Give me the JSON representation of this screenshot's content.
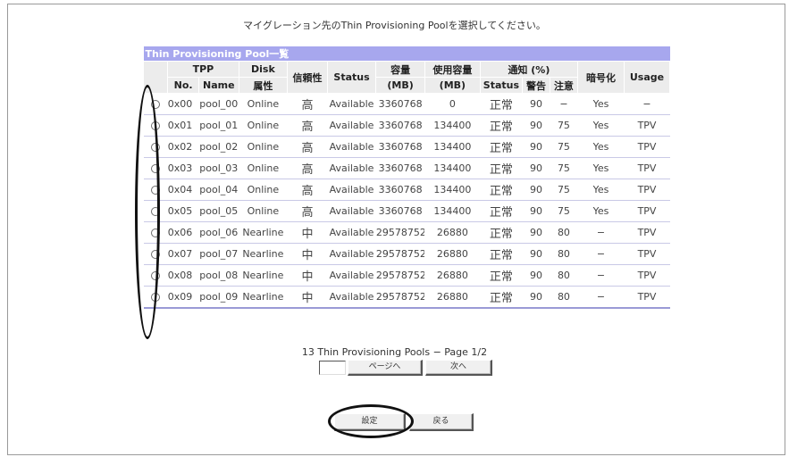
{
  "instruction": "マイグレーション先のThin Provisioning Poolを選択してください。",
  "table": {
    "title": "Thin Provisioning Pool一覧",
    "headers": {
      "tpp": "TPP",
      "no": "No.",
      "name": "Name",
      "disk_line1": "Disk",
      "disk_line2": "属性",
      "reliability": "信頼性",
      "status": "Status",
      "capacity_line1": "容量",
      "capacity_line2": "(MB)",
      "used_line1": "使用容量",
      "used_line2": "(MB)",
      "notify": "通知 (%)",
      "notify_status": "Status",
      "notify_warning": "警告",
      "notify_caution": "注意",
      "encryption": "暗号化",
      "usage": "Usage"
    },
    "rows": [
      {
        "no": "0x00",
        "name": "pool_00",
        "disk": "Online",
        "rel": "高",
        "status": "Available",
        "cap": "3360768",
        "used": "0",
        "nstat": "正常",
        "warn": "90",
        "caut": "−",
        "enc": "Yes",
        "usage": "−"
      },
      {
        "no": "0x01",
        "name": "pool_01",
        "disk": "Online",
        "rel": "高",
        "status": "Available",
        "cap": "3360768",
        "used": "134400",
        "nstat": "正常",
        "warn": "90",
        "caut": "75",
        "enc": "Yes",
        "usage": "TPV"
      },
      {
        "no": "0x02",
        "name": "pool_02",
        "disk": "Online",
        "rel": "高",
        "status": "Available",
        "cap": "3360768",
        "used": "134400",
        "nstat": "正常",
        "warn": "90",
        "caut": "75",
        "enc": "Yes",
        "usage": "TPV"
      },
      {
        "no": "0x03",
        "name": "pool_03",
        "disk": "Online",
        "rel": "高",
        "status": "Available",
        "cap": "3360768",
        "used": "134400",
        "nstat": "正常",
        "warn": "90",
        "caut": "75",
        "enc": "Yes",
        "usage": "TPV"
      },
      {
        "no": "0x04",
        "name": "pool_04",
        "disk": "Online",
        "rel": "高",
        "status": "Available",
        "cap": "3360768",
        "used": "134400",
        "nstat": "正常",
        "warn": "90",
        "caut": "75",
        "enc": "Yes",
        "usage": "TPV"
      },
      {
        "no": "0x05",
        "name": "pool_05",
        "disk": "Online",
        "rel": "高",
        "status": "Available",
        "cap": "3360768",
        "used": "134400",
        "nstat": "正常",
        "warn": "90",
        "caut": "75",
        "enc": "Yes",
        "usage": "TPV"
      },
      {
        "no": "0x06",
        "name": "pool_06",
        "disk": "Nearline",
        "rel": "中",
        "status": "Available",
        "cap": "29578752",
        "used": "26880",
        "nstat": "正常",
        "warn": "90",
        "caut": "80",
        "enc": "−",
        "usage": "TPV"
      },
      {
        "no": "0x07",
        "name": "pool_07",
        "disk": "Nearline",
        "rel": "中",
        "status": "Available",
        "cap": "29578752",
        "used": "26880",
        "nstat": "正常",
        "warn": "90",
        "caut": "80",
        "enc": "−",
        "usage": "TPV"
      },
      {
        "no": "0x08",
        "name": "pool_08",
        "disk": "Nearline",
        "rel": "中",
        "status": "Available",
        "cap": "29578752",
        "used": "26880",
        "nstat": "正常",
        "warn": "90",
        "caut": "80",
        "enc": "−",
        "usage": "TPV"
      },
      {
        "no": "0x09",
        "name": "pool_09",
        "disk": "Nearline",
        "rel": "中",
        "status": "Available",
        "cap": "29578752",
        "used": "26880",
        "nstat": "正常",
        "warn": "90",
        "caut": "80",
        "enc": "−",
        "usage": "TPV"
      }
    ]
  },
  "pager": {
    "summary": "13 Thin Provisioning Pools − Page 1/2",
    "goto_label": "ページへ",
    "next_label": "次へ"
  },
  "actions": {
    "set_label": "設定",
    "back_label": "戻る"
  },
  "colors": {
    "title_bar": "#a7a7ee",
    "warning_text": "#e23b3b",
    "caution_text": "#f0a400"
  }
}
